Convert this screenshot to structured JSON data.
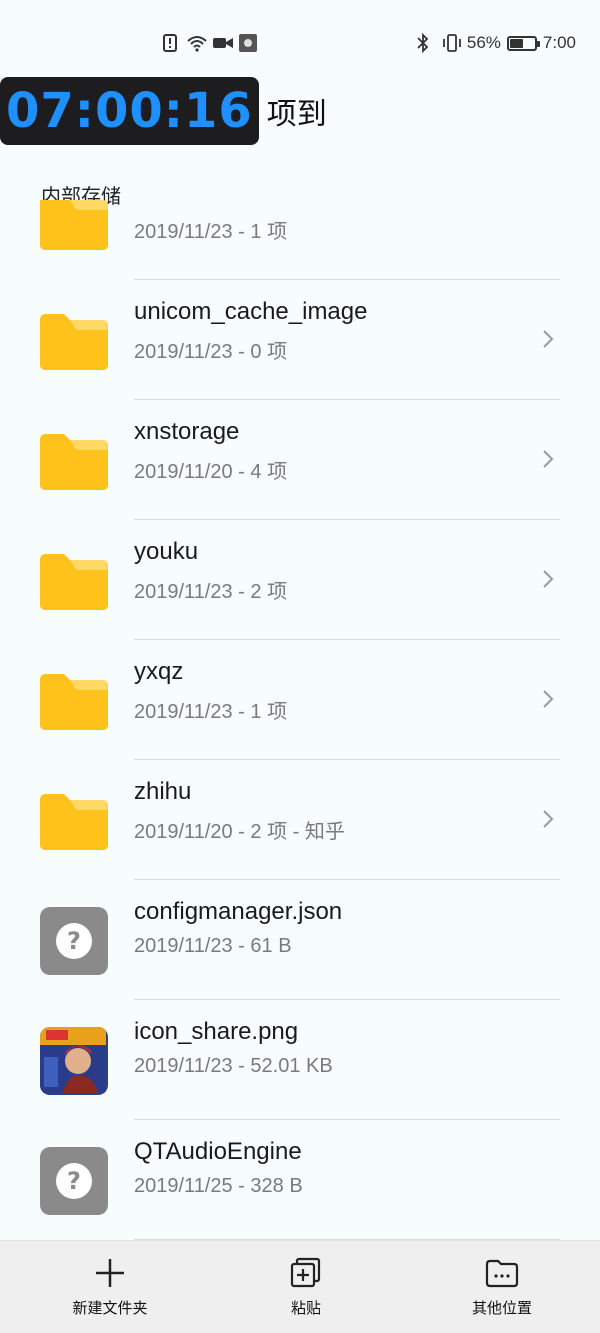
{
  "status_bar": {
    "battery_percent": "56%",
    "battery_level": 0.56,
    "time": "7:00",
    "left_icons": [
      "alert-icon",
      "wifi-icon",
      "video-camera-icon",
      "screen-record-icon"
    ],
    "right_icons": [
      "bluetooth-icon",
      "vibrate-icon"
    ]
  },
  "header": {
    "timer": "07:00:16",
    "title": "项到"
  },
  "breadcrumb": "内部存储",
  "items": [
    {
      "type": "folder",
      "name": "",
      "meta": "2019/11/23 - 1 项"
    },
    {
      "type": "folder",
      "name": "unicom_cache_image",
      "meta": "2019/11/23 - 0 项"
    },
    {
      "type": "folder",
      "name": "xnstorage",
      "meta": "2019/11/20 - 4 项"
    },
    {
      "type": "folder",
      "name": "youku",
      "meta": "2019/11/23 - 2 项"
    },
    {
      "type": "folder",
      "name": "yxqz",
      "meta": "2019/11/23 - 1 项"
    },
    {
      "type": "folder",
      "name": "zhihu",
      "meta": "2019/11/20 - 2 项 - 知乎"
    },
    {
      "type": "unknown-file",
      "name": "configmanager.json",
      "meta": "2019/11/23 - 61 B"
    },
    {
      "type": "image-file",
      "name": "icon_share.png",
      "meta": "2019/11/23 - 52.01 KB"
    },
    {
      "type": "unknown-file",
      "name": "QTAudioEngine",
      "meta": "2019/11/25 - 328 B"
    }
  ],
  "bottom_bar": {
    "new_folder": "新建文件夹",
    "paste": "粘贴",
    "other_locations": "其他位置"
  },
  "colors": {
    "folder": "#ffc21a",
    "folder_tab": "#ffd866",
    "timer_text": "#1e90ff",
    "timer_bg": "#1d1d1f",
    "background": "#f6fdfc"
  }
}
